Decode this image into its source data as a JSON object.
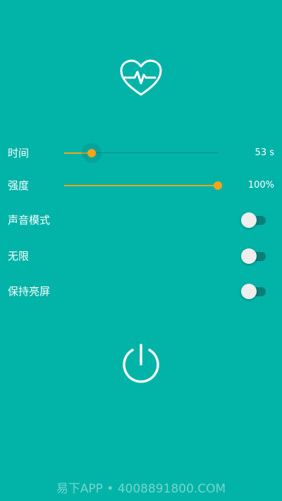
{
  "colors": {
    "background": "#02b3a8",
    "accent": "#f7a21b",
    "track": "#0a8b88",
    "toggle_track": "#0a7f78",
    "toggle_knob": "#eeeeee"
  },
  "logo": {
    "icon": "heart-pulse-icon"
  },
  "settings": {
    "time": {
      "label": "时间",
      "value_text": "53 s",
      "fraction": 0.18
    },
    "intensity": {
      "label": "强度",
      "value_text": "100%",
      "fraction": 1.0
    },
    "sound_mode": {
      "label": "声音模式",
      "on": false
    },
    "unlimited": {
      "label": "无限",
      "on": false
    },
    "keep_screen_on": {
      "label": "保持亮屏",
      "on": false
    }
  },
  "power": {
    "icon": "power-icon"
  },
  "watermark": "易下APP • 4008891800.COM"
}
